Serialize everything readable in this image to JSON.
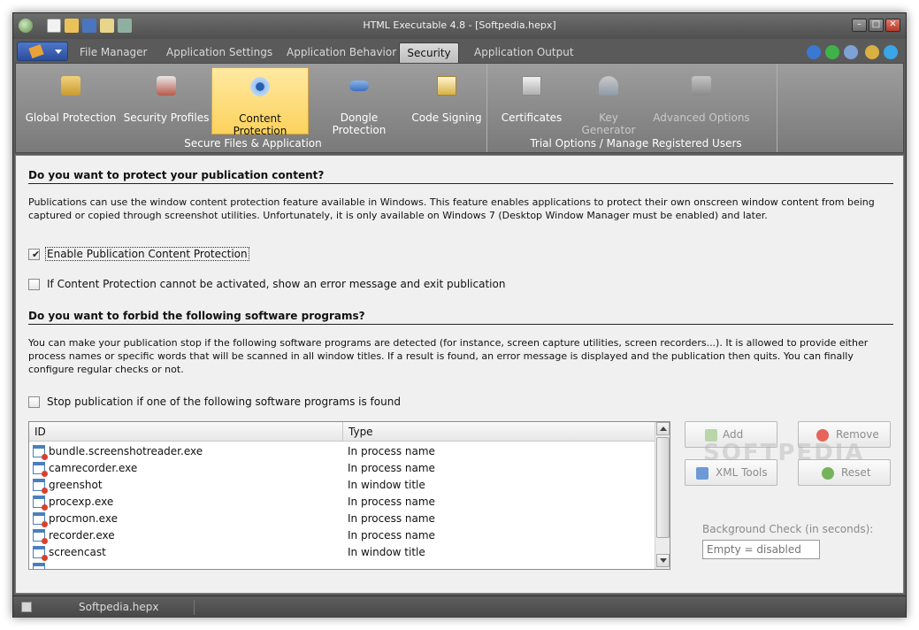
{
  "window": {
    "title": "HTML Executable 4.8 - [Softpedia.hepx]"
  },
  "tabs": [
    "File Manager",
    "Application Settings",
    "Application Behavior",
    "Security",
    "Application Output"
  ],
  "ribbon": {
    "group1": {
      "label": "Secure Files & Application",
      "buttons": [
        "Global Protection",
        "Security Profiles",
        "Content Protection",
        "Dongle Protection",
        "Code Signing"
      ]
    },
    "group2": {
      "label": "Trial Options / Manage Registered Users",
      "buttons": [
        "Certificates",
        "Key Generator",
        "Advanced Options"
      ]
    }
  },
  "section1": {
    "heading": "Do you want to protect your publication content?",
    "text": "Publications can use the window content protection feature available in Windows. This feature enables applications to protect their own onscreen window content from being captured or copied through screenshot utilities. Unfortunately, it is only available on Windows 7 (Desktop Window Manager must be enabled) and later.",
    "enable_label": "Enable Publication Content Protection",
    "error_label": "If Content Protection cannot be activated, show an error message and exit publication"
  },
  "section2": {
    "heading": "Do you want to forbid the following software programs?",
    "text": "You can make your publication stop if the following software programs are detected (for instance, screen capture utilities, screen recorders...). It is allowed to provide either process names or specific words that will be scanned in all window titles. If a result is found, an error message is displayed and the publication then quits. You can finally configure regular checks or not.",
    "stop_label": "Stop publication if one of the following software programs is found"
  },
  "table": {
    "columns": [
      "ID",
      "Type"
    ],
    "rows": [
      {
        "id": "bundle.screenshotreader.exe",
        "type": "In process name"
      },
      {
        "id": "camrecorder.exe",
        "type": "In process name"
      },
      {
        "id": "greenshot",
        "type": "In window title"
      },
      {
        "id": "procexp.exe",
        "type": "In process name"
      },
      {
        "id": "procmon.exe",
        "type": "In process name"
      },
      {
        "id": "recorder.exe",
        "type": "In process name"
      },
      {
        "id": "screencast",
        "type": "In window title"
      }
    ]
  },
  "buttons": {
    "add": "Add",
    "remove": "Remove",
    "xml": "XML Tools",
    "reset": "Reset"
  },
  "background_check": {
    "label": "Background Check (in seconds):",
    "placeholder": "Empty = disabled"
  },
  "status": {
    "file": "Softpedia.hepx"
  },
  "watermark": "SOFTPEDIA"
}
